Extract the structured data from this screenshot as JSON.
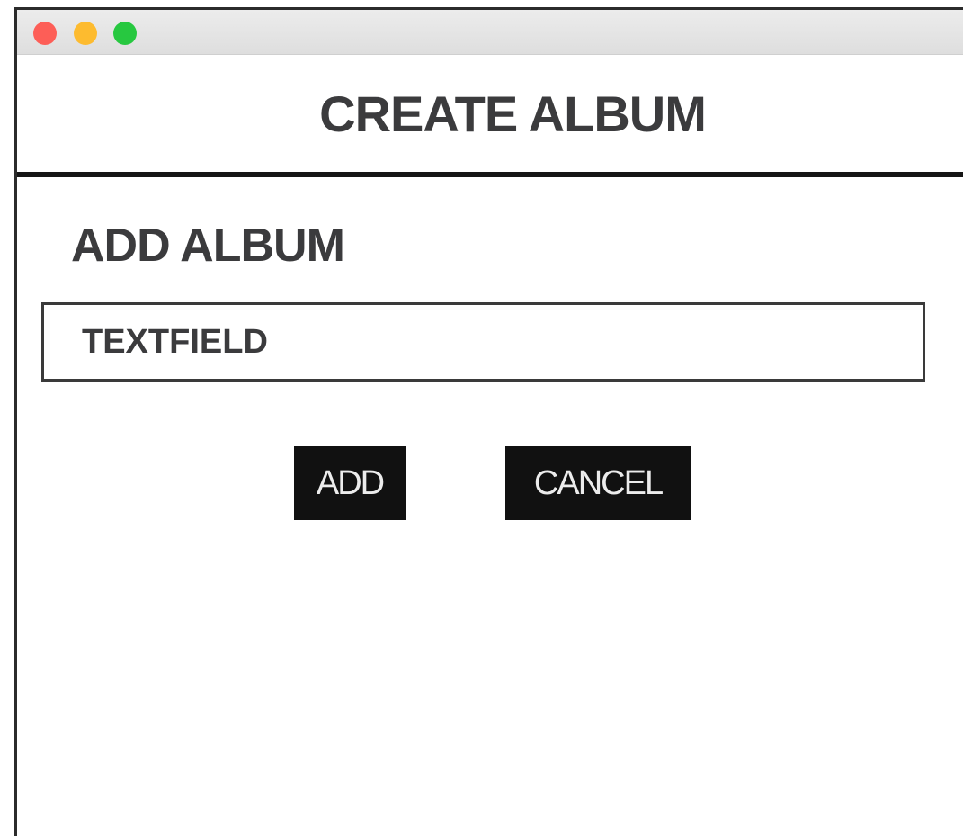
{
  "window": {
    "controls": {
      "close_icon": "close-icon",
      "minimize_icon": "minimize-icon",
      "maximize_icon": "maximize-icon",
      "colors": {
        "close": "#fd5e57",
        "minimize": "#fdbb2f",
        "maximize": "#27c840"
      }
    }
  },
  "header": {
    "title": "CREATE ALBUM"
  },
  "form": {
    "section_title": "ADD ALBUM",
    "textfield": {
      "value": "",
      "placeholder": "TEXTFIELD"
    },
    "add_label": "ADD",
    "cancel_label": "CANCEL"
  },
  "colors": {
    "button_bg": "#111111",
    "button_text": "#ececec",
    "text": "#3b3b3d"
  }
}
